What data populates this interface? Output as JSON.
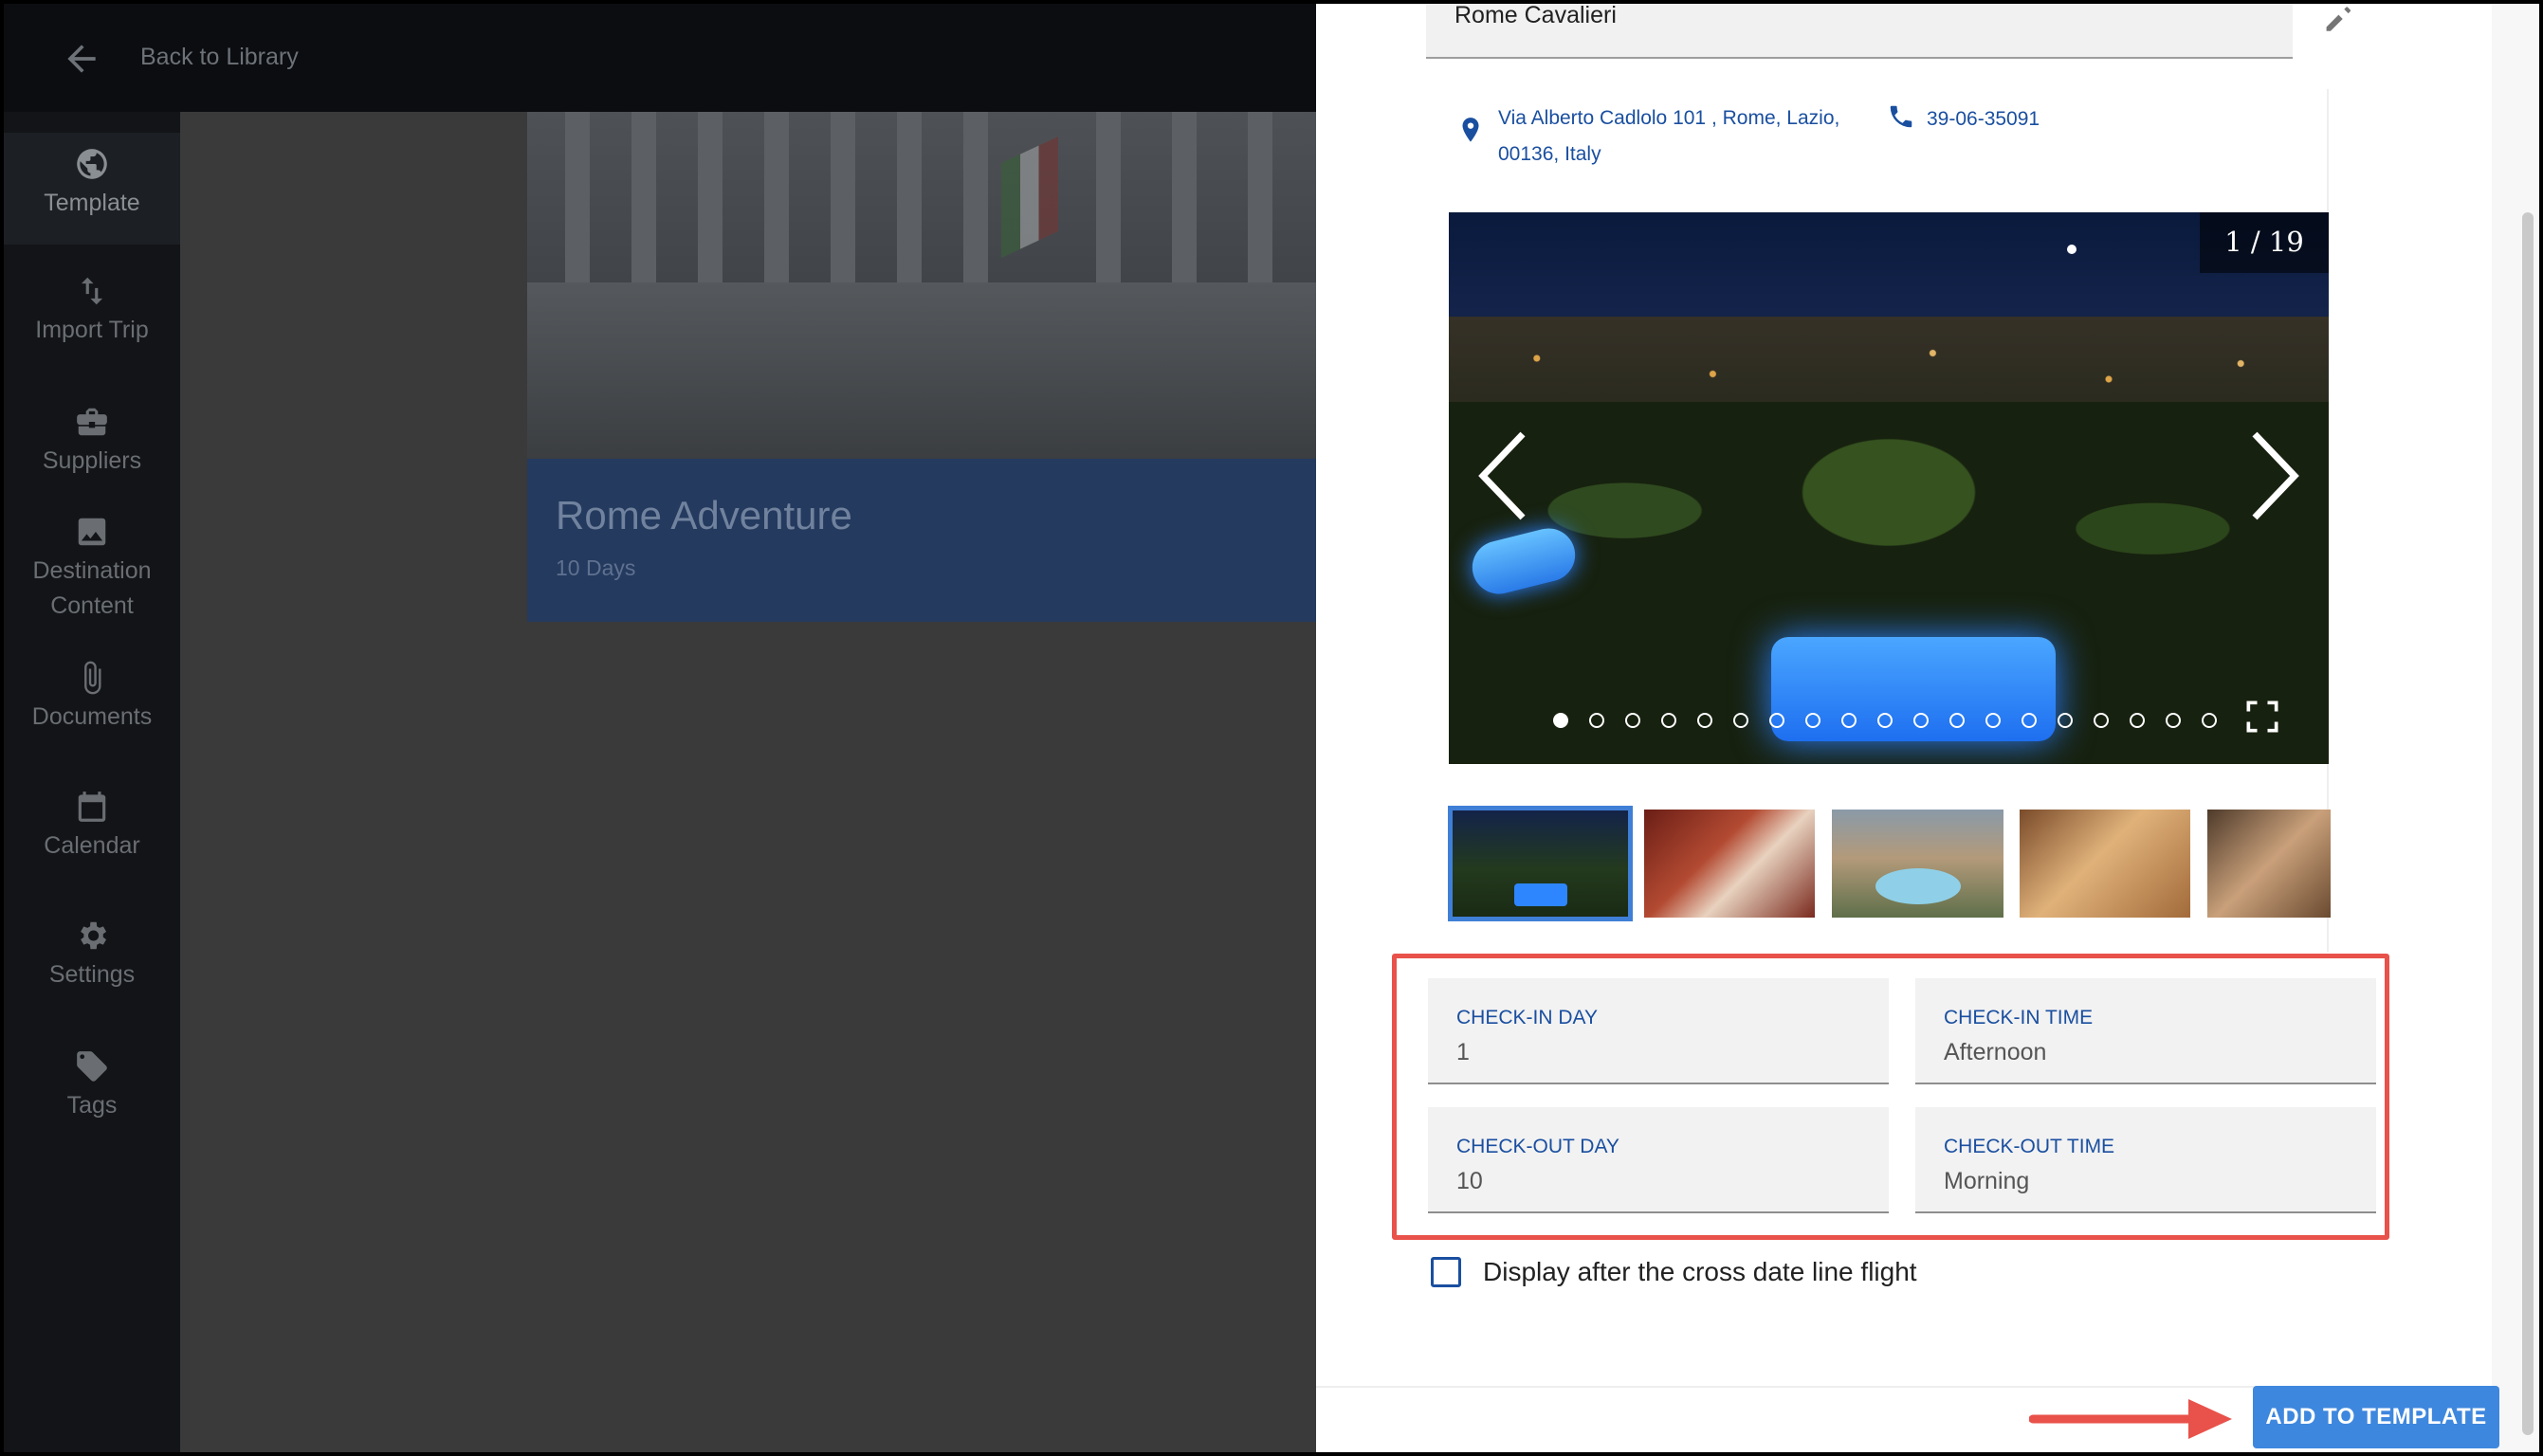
{
  "header": {
    "back_label": "Back to Library"
  },
  "sidebar": {
    "items": [
      {
        "label": "Template",
        "icon": "globe-icon"
      },
      {
        "label": "Import Trip",
        "icon": "swap-vertical-icon"
      },
      {
        "label": "Suppliers",
        "icon": "briefcase-icon"
      },
      {
        "label": "Destination Content",
        "icon": "image-icon"
      },
      {
        "label": "Documents",
        "icon": "paperclip-icon"
      },
      {
        "label": "Calendar",
        "icon": "calendar-icon"
      },
      {
        "label": "Settings",
        "icon": "gear-icon"
      },
      {
        "label": "Tags",
        "icon": "tag-icon"
      }
    ]
  },
  "trip": {
    "title": "Rome Adventure",
    "duration": "10 Days"
  },
  "hotel": {
    "name": "Rome Cavalieri",
    "address_line1": "Via Alberto Cadlolo 101 , Rome, Lazio,",
    "address_line2": "00136, Italy",
    "phone": "39-06-35091"
  },
  "gallery": {
    "counter": "1 / 19",
    "current": 1,
    "total": 19,
    "thumbnail_count": 5
  },
  "checkin": {
    "day_label": "CHECK-IN DAY",
    "day_value": "1",
    "time_label": "CHECK-IN TIME",
    "time_value": "Afternoon"
  },
  "checkout": {
    "day_label": "CHECK-OUT DAY",
    "day_value": "10",
    "time_label": "CHECK-OUT TIME",
    "time_value": "Morning"
  },
  "cross_date": {
    "label": "Display after the cross date line flight",
    "checked": false
  },
  "actions": {
    "add_label": "ADD TO TEMPLATE"
  },
  "colors": {
    "accent": "#3e87de",
    "link": "#1a4fa0",
    "highlight": "#e8524a"
  }
}
